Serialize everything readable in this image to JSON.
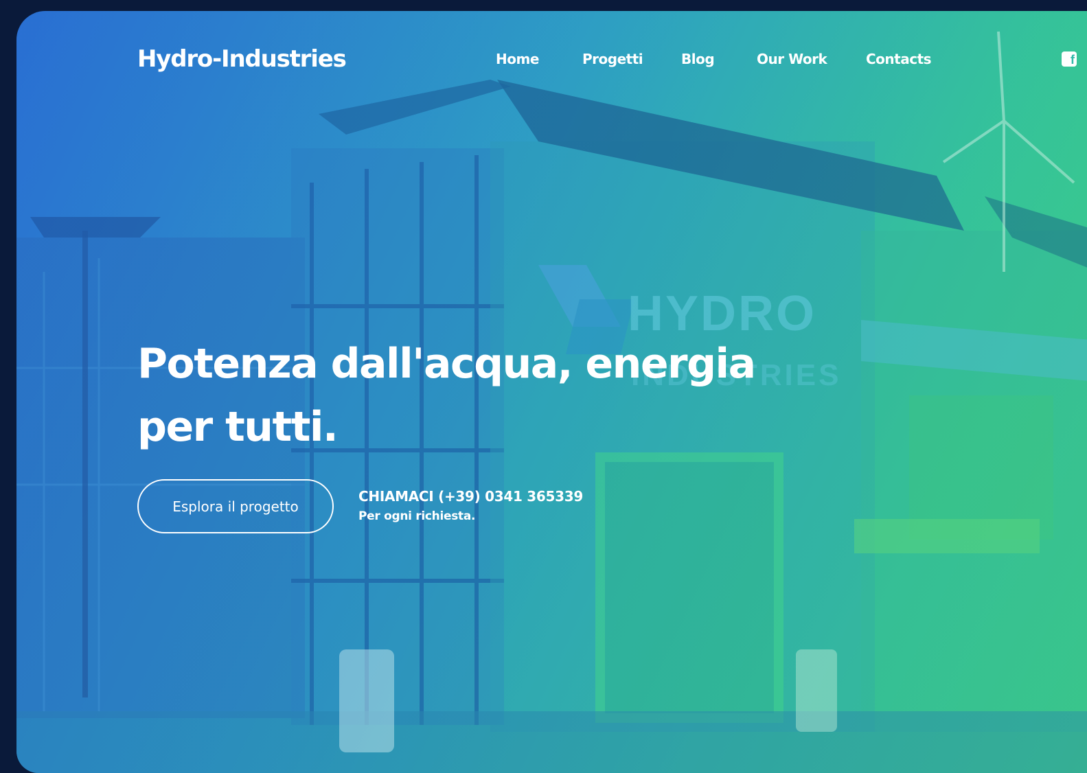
{
  "brand": {
    "name": "Hydro-Industries"
  },
  "nav": {
    "items": [
      {
        "label": "Home"
      },
      {
        "label": "Progetti"
      },
      {
        "label": "Blog"
      },
      {
        "label": "Our Work"
      },
      {
        "label": "Contacts"
      }
    ],
    "social_icon": "facebook-icon"
  },
  "hero": {
    "title_line1": "Potenza dall'acqua, energia",
    "title_line2": "per tutti.",
    "cta_label": "Esplora il progetto",
    "call_label": "CHIAMACI (+39) 0341 365339",
    "call_sub": "Per ogni richiesta."
  },
  "background": {
    "sign_line1": "HYDRO",
    "sign_line2": "INDUSTRIES"
  },
  "colors": {
    "gradient_start": "#2a6fd3",
    "gradient_mid": "#2f9fc4",
    "gradient_end": "#3fd080",
    "page_bg": "#0a1a3a",
    "text": "#ffffff"
  }
}
